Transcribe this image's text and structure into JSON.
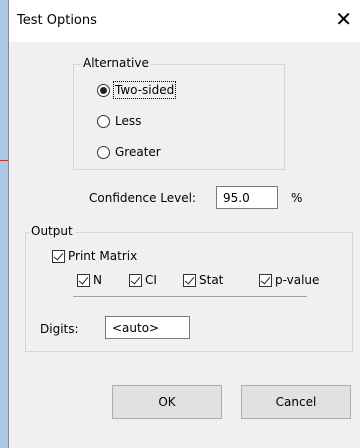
{
  "window": {
    "title": "Test Options",
    "close_glyph": "✕"
  },
  "alternative": {
    "label": "Alternative",
    "options": [
      {
        "label": "Two-sided",
        "selected": true
      },
      {
        "label": "Less",
        "selected": false
      },
      {
        "label": "Greater",
        "selected": false
      }
    ]
  },
  "confidence": {
    "label": "Confidence Level:",
    "value": "95.0",
    "unit": "%"
  },
  "output": {
    "label": "Output",
    "print_matrix": {
      "label": "Print Matrix",
      "checked": true
    },
    "columns": [
      {
        "label": "N",
        "checked": true
      },
      {
        "label": "CI",
        "checked": true
      },
      {
        "label": "Stat",
        "checked": true
      },
      {
        "label": "p-value",
        "checked": true
      }
    ],
    "digits": {
      "label": "Digits:",
      "value": "<auto>"
    }
  },
  "buttons": {
    "ok": "OK",
    "cancel": "Cancel"
  }
}
